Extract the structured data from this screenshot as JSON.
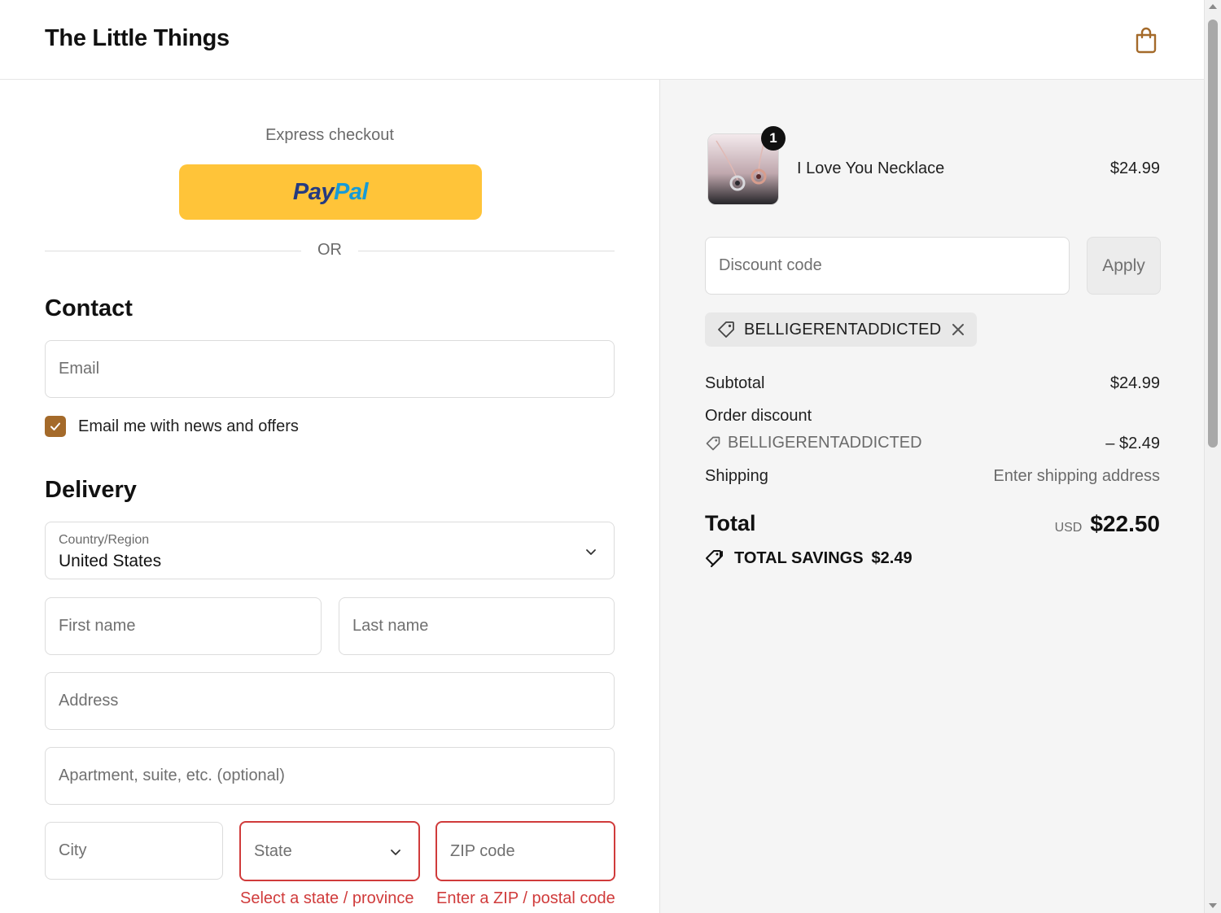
{
  "header": {
    "brand": "The Little Things",
    "cart_icon": "shopping-bag-icon"
  },
  "express": {
    "label": "Express checkout",
    "paypal_pay": "Pay",
    "paypal_pal": "Pal",
    "or_text": "OR"
  },
  "contact": {
    "title": "Contact",
    "email_placeholder": "Email",
    "newsletter_label": "Email me with news and offers",
    "newsletter_checked": true
  },
  "delivery": {
    "title": "Delivery",
    "country_caption": "Country/Region",
    "country_value": "United States",
    "first_name_placeholder": "First name",
    "last_name_placeholder": "Last name",
    "address_placeholder": "Address",
    "apartment_placeholder": "Apartment, suite, etc. (optional)",
    "city_placeholder": "City",
    "state_placeholder": "State",
    "zip_placeholder": "ZIP code",
    "state_error": "Select a state / province",
    "zip_error": "Enter a ZIP / postal code"
  },
  "summary": {
    "item": {
      "name": "I Love You Necklace",
      "price": "$24.99",
      "quantity": "1"
    },
    "discount_placeholder": "Discount code",
    "apply_label": "Apply",
    "applied_code": "BELLIGERENTADDICTED",
    "subtotal_label": "Subtotal",
    "subtotal_value": "$24.99",
    "order_discount_label": "Order discount",
    "order_discount_code": "BELLIGERENTADDICTED",
    "order_discount_value": "– $2.49",
    "shipping_label": "Shipping",
    "shipping_value": "Enter shipping address",
    "total_label": "Total",
    "currency": "USD",
    "total_value": "$22.50",
    "savings_label": "TOTAL SAVINGS",
    "savings_value": "$2.49"
  },
  "colors": {
    "accent": "#a46a2a",
    "paypal_yellow": "#ffc439",
    "error": "#d03b3b",
    "sidebar_bg": "#f5f5f5"
  }
}
